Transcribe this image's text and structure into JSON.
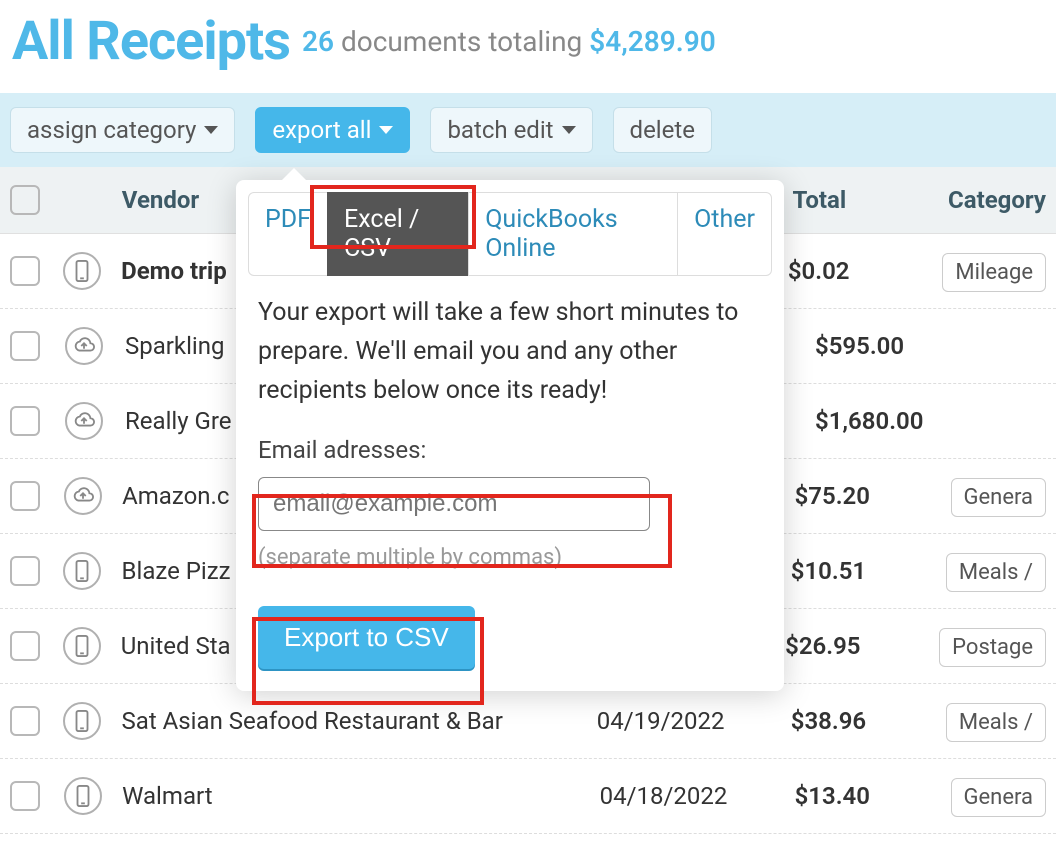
{
  "header": {
    "title": "All Receipts",
    "count": "26",
    "summary_mid": "documents totaling",
    "total": "$4,289.90"
  },
  "toolbar": {
    "assign_category": "assign category",
    "export_all": "export all",
    "batch_edit": "batch edit",
    "delete": "delete"
  },
  "columns": {
    "vendor": "Vendor",
    "total": "Total",
    "category": "Category"
  },
  "rows": [
    {
      "icon": "phone",
      "vendor": "Demo trip",
      "bold": true,
      "date": "",
      "total": "$0.02",
      "category": "Mileage"
    },
    {
      "icon": "cloud",
      "vendor": "Sparkling",
      "date": "",
      "total": "$595.00",
      "category": ""
    },
    {
      "icon": "cloud",
      "vendor": "Really Gre",
      "date": "",
      "total": "$1,680.00",
      "category": ""
    },
    {
      "icon": "cloud",
      "vendor": "Amazon.c",
      "date": "",
      "total": "$75.20",
      "category": "Genera"
    },
    {
      "icon": "phone",
      "vendor": "Blaze Pizz",
      "date": "",
      "total": "$10.51",
      "category": "Meals /"
    },
    {
      "icon": "phone",
      "vendor": "United Sta",
      "date": "",
      "total": "$26.95",
      "category": "Postage"
    },
    {
      "icon": "phone",
      "vendor": "Sat Asian Seafood Restaurant & Bar",
      "date": "04/19/2022",
      "total": "$38.96",
      "category": "Meals /"
    },
    {
      "icon": "phone",
      "vendor": "Walmart",
      "date": "04/18/2022",
      "total": "$13.40",
      "category": "Genera"
    }
  ],
  "popover": {
    "tabs": {
      "pdf": "PDF",
      "excel": "Excel / CSV",
      "qbo": "QuickBooks Online",
      "other": "Other"
    },
    "body": "Your export will take a few short minutes to prepare. We'll email you and any other recipients below once its ready!",
    "email_label": "Email adresses:",
    "email_placeholder": "email@example.com",
    "hint": "(separate multiple by commas)",
    "cta": "Export to CSV"
  }
}
